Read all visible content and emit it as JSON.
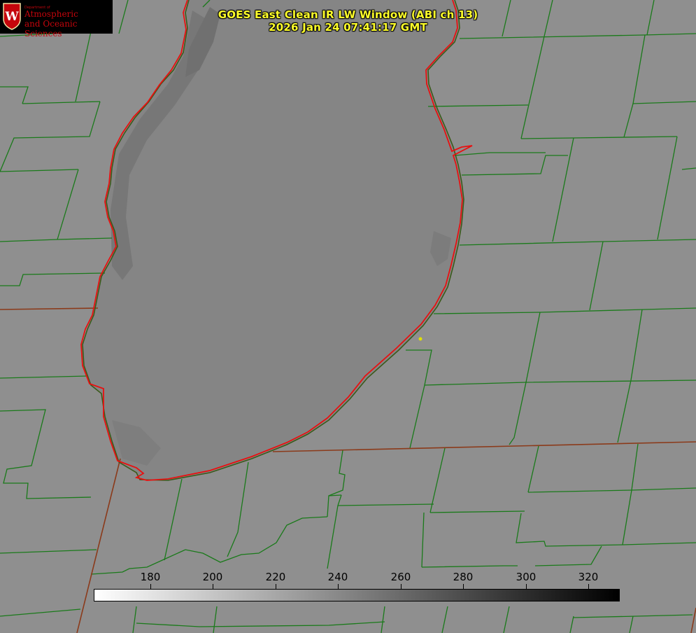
{
  "header": {
    "title_line1": "GOES East Clean IR LW Window (ABI ch 13)",
    "title_line2": "2026 Jan 24 07:41:17 GMT"
  },
  "logo": {
    "small": "Department of",
    "line1": "Atmospheric",
    "line2": "and Oceanic Sciences",
    "letter": "W"
  },
  "colorbar": {
    "ticks": [
      "180",
      "200",
      "220",
      "240",
      "260",
      "280",
      "300",
      "320"
    ]
  },
  "colors": {
    "title": "#ffff2a",
    "county_lines": "#1a7a1a",
    "state_lines": "#8b3a1a",
    "lake_outline": "#e81010",
    "background": "#8e8e8e",
    "lake": "#8a8a8a",
    "marker": "#e0e000"
  }
}
